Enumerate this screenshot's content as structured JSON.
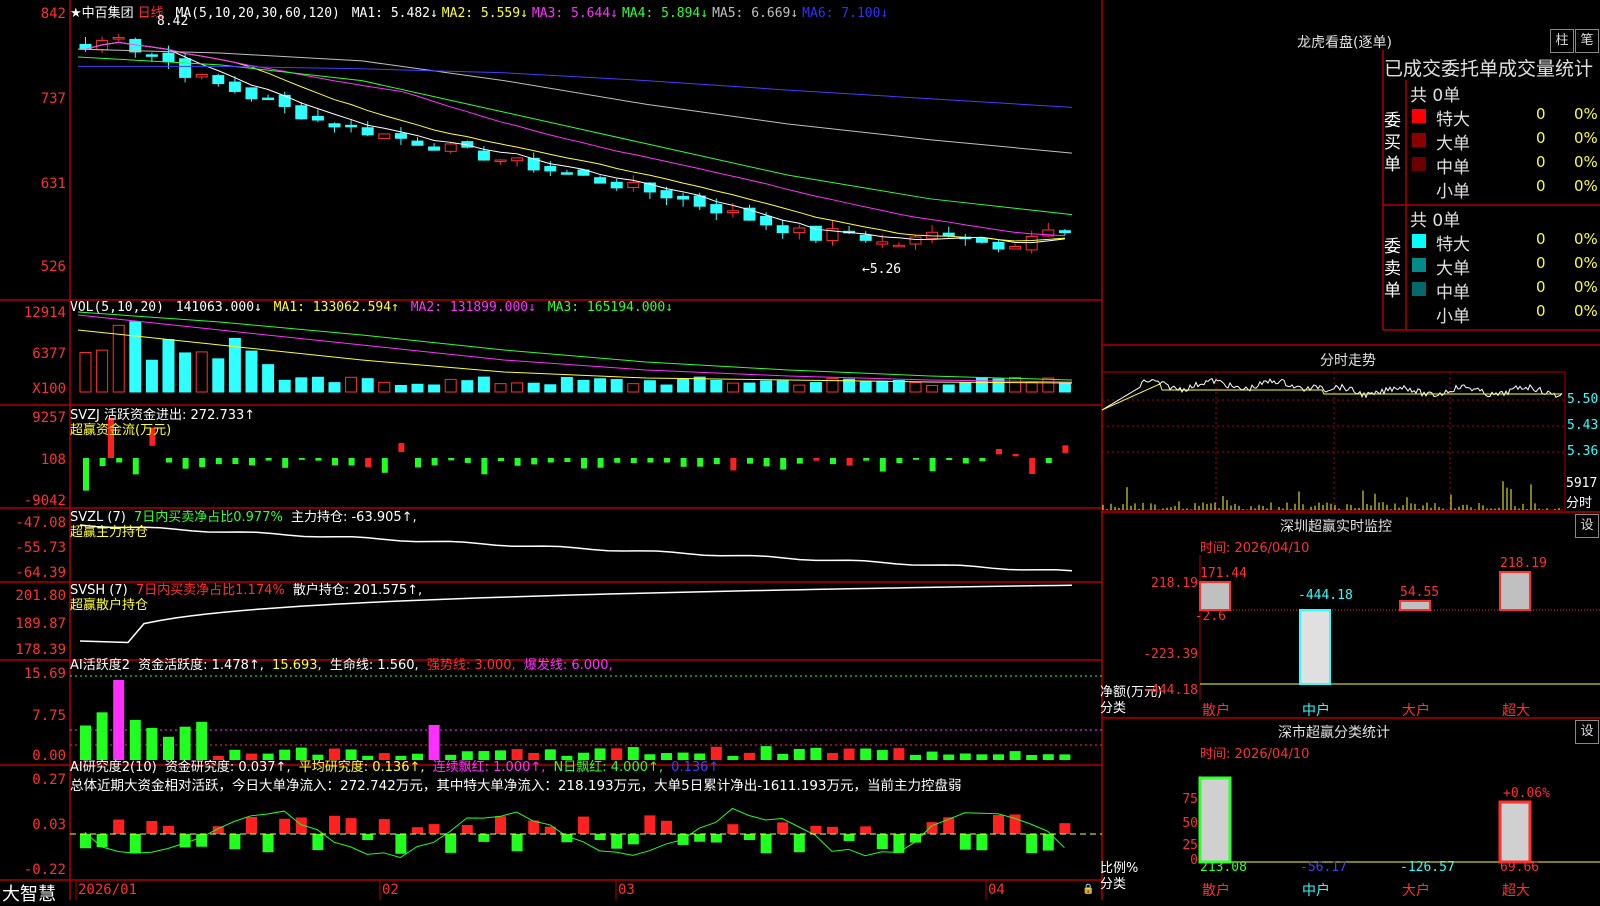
{
  "main": {
    "stock_name": "★中百集团",
    "period": "日线",
    "ma_label": "MA(5,10,20,30,60,120)",
    "ma": [
      {
        "name": "MA1:",
        "value": "5.482↓",
        "color": "#ffffff"
      },
      {
        "name": "MA2:",
        "value": "5.559↓",
        "color": "#ffff30"
      },
      {
        "name": "MA3:",
        "value": "5.644↓",
        "color": "#ff30ff"
      },
      {
        "name": "MA4:",
        "value": "5.894↓",
        "color": "#30ff30"
      },
      {
        "name": "MA5:",
        "value": "6.669↓",
        "color": "#c0c0c0"
      },
      {
        "name": "MA6:",
        "value": "7.100↓",
        "color": "#3030ff"
      }
    ],
    "y_axis": [
      "842",
      "737",
      "631",
      "526"
    ],
    "high_mark": "8.42",
    "low_mark": "←5.26"
  },
  "vol": {
    "header": "VOL(5,10,20)",
    "value": "141063.000↓",
    "ma1": "MA1: 133062.594↑",
    "ma2": "MA2: 131899.000↓",
    "ma3": "MA3: 165194.000↓",
    "y_axis": [
      "12914",
      "6377"
    ],
    "unit": "X100"
  },
  "svzj": {
    "header": "SVZJ  活跃资金进出: 272.733↑",
    "subtitle": "超赢资金流(万元)",
    "y_axis": [
      "9257",
      "108",
      "-9042"
    ]
  },
  "svzl": {
    "header": "SVZL (7)",
    "ratio": "7日内买卖净占比0.977%",
    "hold": "主力持仓: -63.905↑,",
    "subtitle": "超赢主力持仓",
    "y_axis": [
      "-47.08",
      "-55.73",
      "-64.39"
    ]
  },
  "svsh": {
    "header": "SVSH (7)",
    "ratio": "7日内买卖净占比1.174%",
    "hold": "散户持仓: 201.575↑,",
    "subtitle": "超赢散户持仓",
    "y_axis": [
      "201.80",
      "189.87",
      "178.39"
    ]
  },
  "ai1": {
    "header": "AI活跃度2",
    "v1": "资金活跃度: 1.478↑,",
    "v2": "15.693,",
    "v3": "生命线: 1.560,",
    "v4": "强势线: 3.000,",
    "v5": "爆发线: 6.000,",
    "y_axis": [
      "15.69",
      "7.75",
      "0.00"
    ]
  },
  "ai2": {
    "header": "AI研究度2(10)",
    "v1": "资金研究度: 0.037↑,",
    "v2": "平均研究度: 0.136↑,",
    "v3": "连续飘红: 1.000↑,",
    "v4": "N日飘红: 4.000↑,",
    "v5": "0.136↑",
    "summary": "总体近期大资金相对活跃，今日大单净流入：272.742万元，其中特大单净流入：218.193万元，大单5日累计净出-1611.193万元，当前主力控盘弱",
    "y_axis": [
      "0.27",
      "0.03",
      "-0.22"
    ]
  },
  "xaxis": {
    "brand": "大智慧",
    "labels": [
      "2026/01",
      "02",
      "03",
      "04"
    ]
  },
  "right": {
    "longhu_title": "龙虎看盘(逐单)",
    "btn_zhu": "柱",
    "btn_bi": "笔",
    "stats_title": "已成交委托单成交量统计",
    "buy_label": "委买单",
    "sell_label": "委卖单",
    "buy_total": "共 0单",
    "sell_total": "共 0单",
    "rows": [
      {
        "name": "特大",
        "v1": "0",
        "v2": "0%"
      },
      {
        "name": "大单",
        "v1": "0",
        "v2": "0%"
      },
      {
        "name": "中单",
        "v1": "0",
        "v2": "0%"
      },
      {
        "name": "小单",
        "v1": "0",
        "v2": "0%"
      }
    ],
    "buy_colors": [
      "#ff0000",
      "#8b0000",
      "#6a0000",
      "#000000"
    ],
    "sell_colors": [
      "#00ffff",
      "#008b8b",
      "#006a6a",
      "#000000"
    ],
    "intraday_title": "分时走势",
    "intraday_prices": [
      "5.50",
      "5.43",
      "5.36"
    ],
    "intraday_vol": "5917",
    "intraday_vol_unit": "分时",
    "sz_title": "深圳超赢实时监控",
    "sz_set": "设",
    "sz_time": "时间: 2026/04/10",
    "sz_yaxis": [
      "218.19",
      "-2.6",
      "-223.39",
      "-444.18"
    ],
    "sz_axis_label1": "净额(万元)",
    "sz_axis_label2": "分类",
    "sz_values": [
      "171.44",
      "-444.18",
      "54.55",
      "218.19"
    ],
    "sz_cats": [
      "散户",
      "中户",
      "大户",
      "超大"
    ],
    "sh_title": "深市超赢分类统计",
    "sh_set": "设",
    "sh_time": "时间: 2026/04/10",
    "sh_yaxis": [
      "75",
      "50",
      "25",
      "0"
    ],
    "sh_axis_label1": "比例%",
    "sh_axis_label2": "分类",
    "sh_pct": "+0.06%",
    "sh_values": [
      "213.08",
      "-56.17",
      "-126.57",
      "69.66"
    ],
    "sh_cats": [
      "散户",
      "中户",
      "大户",
      "超大"
    ]
  }
}
